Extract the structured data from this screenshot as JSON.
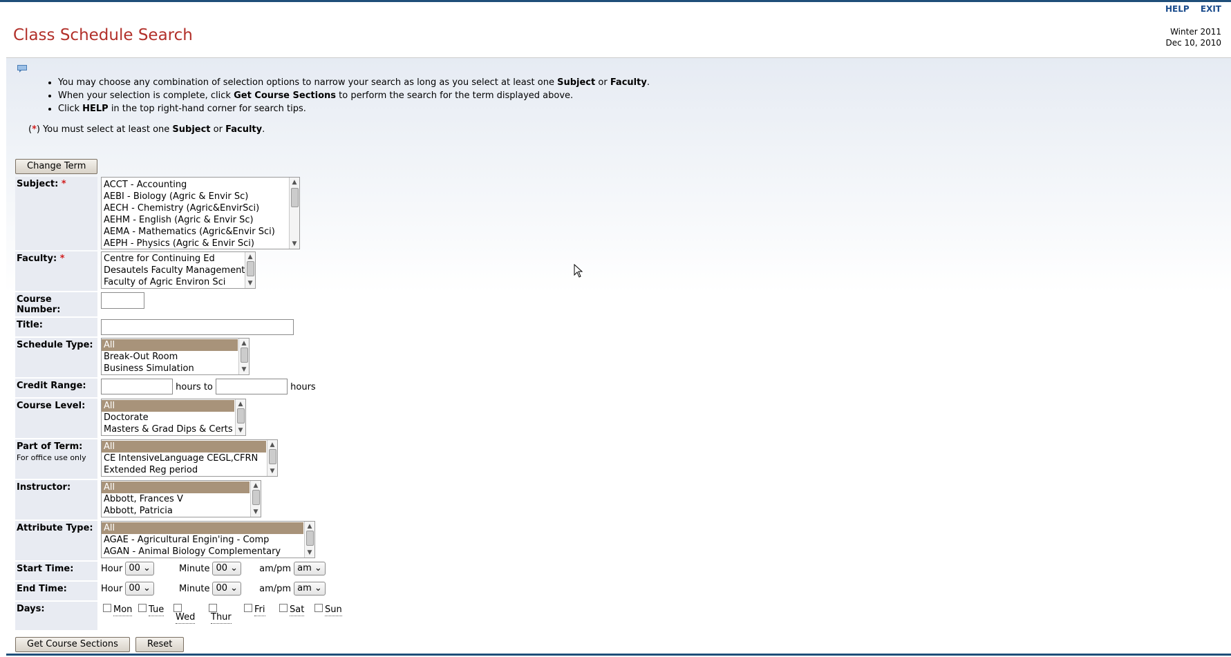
{
  "header": {
    "links": [
      "HELP",
      "EXIT"
    ],
    "title": "Class Schedule Search",
    "term": "Winter 2011",
    "date": "Dec 10, 2010"
  },
  "instructions": {
    "bullet1_pre": "You may choose any combination of selection options to narrow your search as long as you select at least one ",
    "bullet1_b1": "Subject",
    "bullet1_mid": " or ",
    "bullet1_b2": "Faculty",
    "bullet1_post": ".",
    "bullet2_pre": "When your selection is complete, click ",
    "bullet2_b": "Get Course Sections",
    "bullet2_post": " to perform the search for the term displayed above.",
    "bullet3_pre": "Click ",
    "bullet3_b": "HELP",
    "bullet3_post": " in the top right-hand corner for search tips.",
    "req_open": "(",
    "req_star": "*",
    "req_close": ") You must select at least one ",
    "req_b1": "Subject",
    "req_mid": " or ",
    "req_b2": "Faculty",
    "req_end": "."
  },
  "buttons": {
    "change_term": "Change Term",
    "get_sections": "Get Course Sections",
    "reset": "Reset"
  },
  "labels": {
    "subject": "Subject:",
    "faculty": "Faculty:",
    "course_number": "Course Number:",
    "title": "Title:",
    "schedule_type": "Schedule Type:",
    "credit_range": "Credit Range:",
    "hours_to": "hours to",
    "hours": "hours",
    "course_level": "Course Level:",
    "part_of_term": "Part of Term:",
    "office_use": "For office use only",
    "instructor": "Instructor:",
    "attribute_type": "Attribute Type:",
    "start_time": "Start Time:",
    "end_time": "End Time:",
    "days": "Days:",
    "hour": "Hour",
    "minute": "Minute",
    "ampm": "am/pm",
    "star": "*"
  },
  "subjects": [
    "ACCT - Accounting",
    "AEBI - Biology (Agric & Envir Sc)",
    "AECH - Chemistry (Agric&EnvirSci)",
    "AEHM - English (Agric & Envir Sc)",
    "AEMA - Mathematics (Agric&Envir Sci)",
    "AEPH - Physics (Agric & Envir Sci)"
  ],
  "faculties": [
    "Centre for Continuing Ed",
    "Desautels Faculty Management",
    "Faculty of Agric Environ Sci"
  ],
  "schedule_types": [
    "All",
    "Break-Out Room",
    "Business Simulation"
  ],
  "course_levels": [
    "All",
    "Doctorate",
    "Masters & Grad Dips & Certs"
  ],
  "parts_of_term": [
    "All",
    "CE IntensiveLanguage CEGL,CFRN",
    "Extended Reg period"
  ],
  "instructors": [
    "All",
    "Abbott, Frances V",
    "Abbott, Patricia"
  ],
  "attribute_types": [
    "All",
    "AGAE - Agricultural Engin'ing - Comp",
    "AGAN - Animal Biology Complementary"
  ],
  "time": {
    "start_hour": "00",
    "start_minute": "00",
    "start_ampm": "am",
    "end_hour": "00",
    "end_minute": "00",
    "end_ampm": "am"
  },
  "days": [
    "Mon",
    "Tue",
    "Wed",
    "Thur",
    "Fri",
    "Sat",
    "Sun"
  ],
  "colors": {
    "title": "#b2302a",
    "link": "#1a4b8c",
    "selected": "#a8937a",
    "label_bg": "#e8ebf2"
  }
}
